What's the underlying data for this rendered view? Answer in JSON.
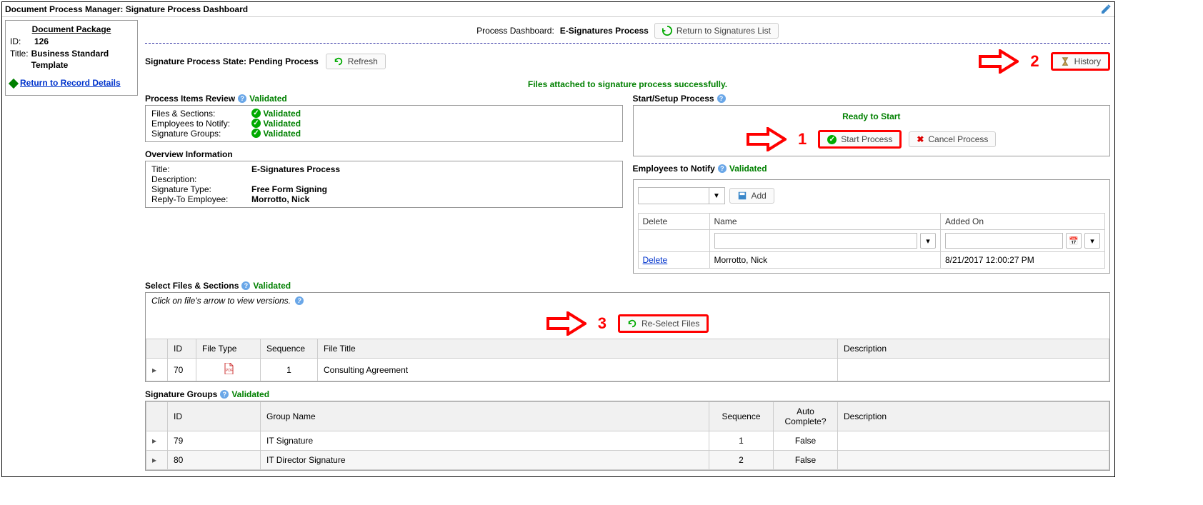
{
  "title": "Document Process Manager: Signature Process Dashboard",
  "package": {
    "heading": "Document Package",
    "id_label": "ID:",
    "id": "126",
    "title_label": "Title:",
    "title": "Business Standard Template",
    "return_link": "Return to Record Details"
  },
  "dashboard": {
    "label": "Process Dashboard:",
    "name": "E-Signatures Process",
    "return_btn": "Return to Signatures List",
    "state_label": "Signature Process State:",
    "state": "Pending Process",
    "refresh_btn": "Refresh",
    "history_btn": "History",
    "success_msg": "Files attached to signature process successfully."
  },
  "annotations": {
    "n1": "1",
    "n2": "2",
    "n3": "3"
  },
  "review": {
    "heading": "Process Items Review",
    "status": "Validated",
    "rows": [
      {
        "label": "Files & Sections:",
        "status": "Validated"
      },
      {
        "label": "Employees to Notify:",
        "status": "Validated"
      },
      {
        "label": "Signature Groups:",
        "status": "Validated"
      }
    ]
  },
  "overview": {
    "heading": "Overview Information",
    "title_label": "Title:",
    "title": "E-Signatures Process",
    "desc_label": "Description:",
    "desc": "",
    "sigtype_label": "Signature Type:",
    "sigtype": "Free Form Signing",
    "reply_label": "Reply-To Employee:",
    "reply": "Morrotto, Nick"
  },
  "start": {
    "heading": "Start/Setup Process",
    "ready": "Ready to Start",
    "start_btn": "Start Process",
    "cancel_btn": "Cancel Process"
  },
  "emp": {
    "heading": "Employees to Notify",
    "status": "Validated",
    "add_btn": "Add",
    "cols": {
      "delete": "Delete",
      "name": "Name",
      "added": "Added On"
    },
    "rows": [
      {
        "delete": "Delete",
        "name": "Morrotto, Nick",
        "added": "8/21/2017 12:00:27 PM"
      }
    ]
  },
  "files": {
    "heading": "Select Files & Sections",
    "status": "Validated",
    "hint": "Click on file's arrow to view versions.",
    "reselect_btn": "Re-Select Files",
    "cols": {
      "id": "ID",
      "type": "File Type",
      "seq": "Sequence",
      "title": "File Title",
      "desc": "Description"
    },
    "rows": [
      {
        "id": "70",
        "type": "pdf",
        "seq": "1",
        "title": "Consulting Agreement",
        "desc": ""
      }
    ]
  },
  "sg": {
    "heading": "Signature Groups",
    "status": "Validated",
    "cols": {
      "id": "ID",
      "name": "Group Name",
      "seq": "Sequence",
      "auto": "Auto Complete?",
      "desc": "Description"
    },
    "rows": [
      {
        "id": "79",
        "name": "IT Signature",
        "seq": "1",
        "auto": "False",
        "desc": ""
      },
      {
        "id": "80",
        "name": "IT Director Signature",
        "seq": "2",
        "auto": "False",
        "desc": ""
      }
    ]
  }
}
